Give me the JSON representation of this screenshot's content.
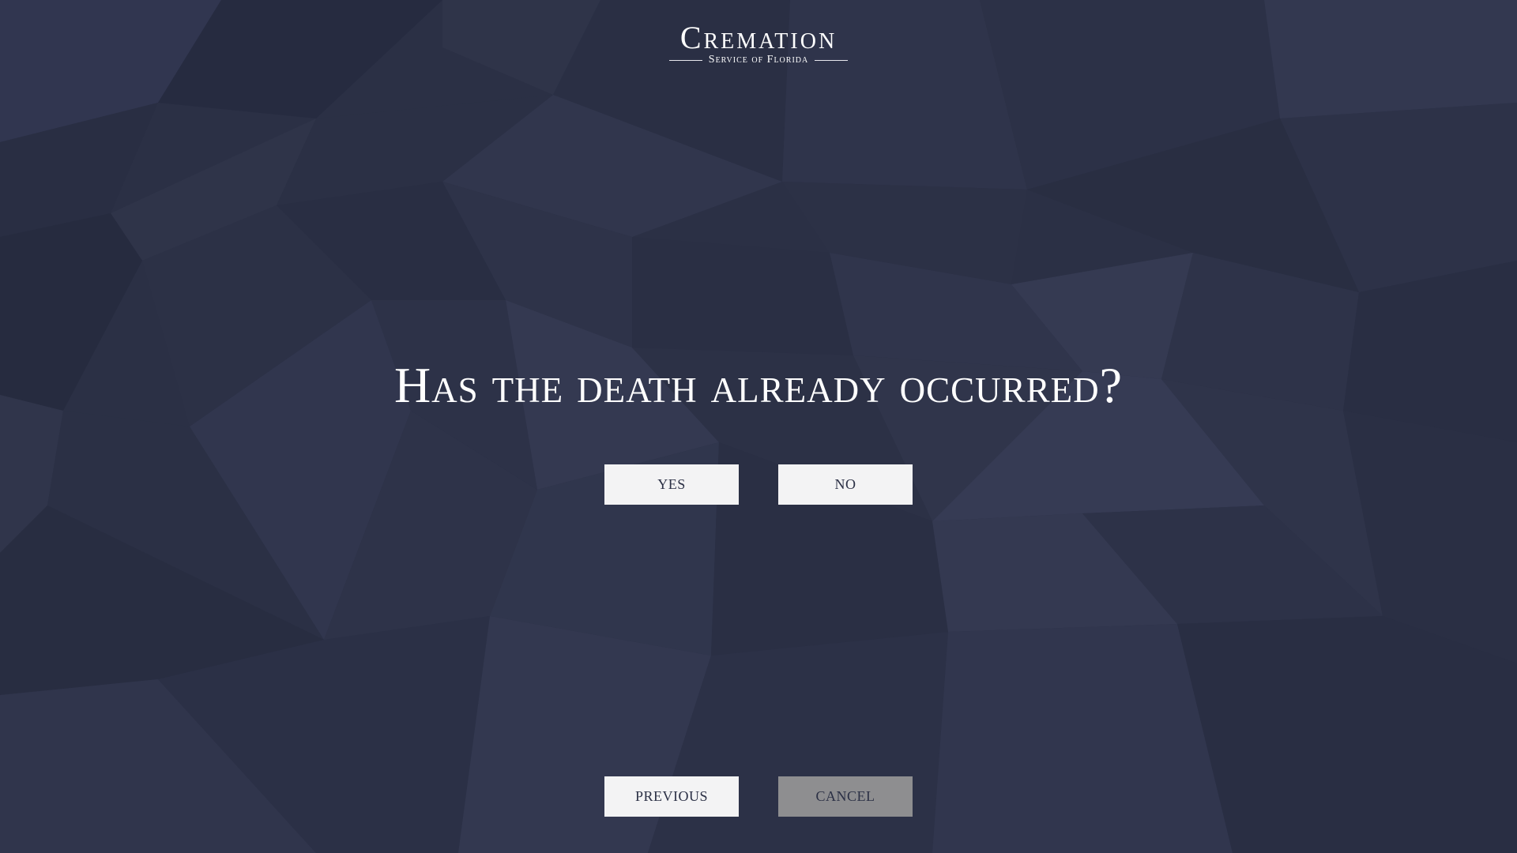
{
  "logo": {
    "main": "Cremation",
    "sub": "Service of Florida"
  },
  "question": "Has the death already occurred?",
  "answers": {
    "yes_label": "YES",
    "no_label": "NO"
  },
  "nav": {
    "previous_label": "PREVIOUS",
    "cancel_label": "CANCEL"
  },
  "colors": {
    "background": "#2b3045",
    "button": "#f3f3f4",
    "cancel_button": "#8e8e90",
    "text": "#ffffff"
  }
}
